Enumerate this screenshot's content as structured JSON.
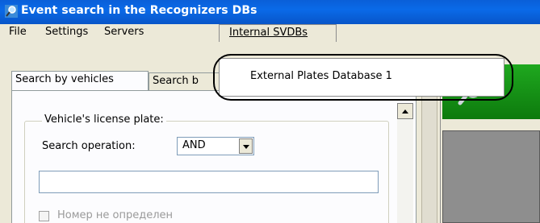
{
  "window": {
    "title": "Event search in the Recognizers DBs",
    "app_icon": "magnifier-icon"
  },
  "menubar": {
    "items": [
      "File",
      "Settings",
      "Servers",
      "Internal SVDBs"
    ],
    "open_menu": {
      "items": [
        "External Plates Database 1"
      ]
    }
  },
  "tabs": [
    "Search by vehicles",
    "Search b"
  ],
  "search_panel": {
    "group_label": "Vehicle's license plate:",
    "operation_label": "Search operation:",
    "operation_value": "AND",
    "plate_value": "",
    "checkbox_label": "Номер не определен",
    "checkbox_checked": false
  },
  "colors": {
    "titlebar": "#0a5fd8",
    "banner": "#1fa81f",
    "highlight_ring": "#000000"
  }
}
